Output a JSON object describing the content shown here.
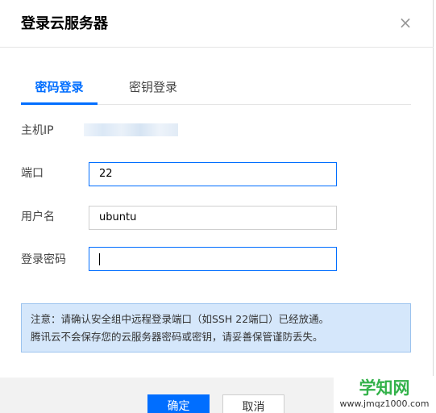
{
  "dialog": {
    "title": "登录云服务器",
    "close_glyph": "×"
  },
  "tabs": [
    {
      "label": "密码登录",
      "active": true
    },
    {
      "label": "密钥登录",
      "active": false
    }
  ],
  "form": {
    "host_label": "主机IP",
    "port_label": "端口",
    "port_value": "22",
    "user_label": "用户名",
    "user_value": "ubuntu",
    "password_label": "登录密码",
    "password_value": ""
  },
  "notice": {
    "line1": "注意：请确认安全组中远程登录端口（如SSH 22端口）已经放通。",
    "line2": "腾讯云不会保存您的云服务器密码或密钥，请妥善保管谨防丢失。"
  },
  "buttons": {
    "confirm": "确定",
    "cancel": "取消"
  },
  "watermark": {
    "title": "学知网",
    "url": "www.jmqz1000.com"
  },
  "colors": {
    "accent": "#006eff",
    "notice_bg": "#d5e7fb",
    "watermark_green": "#33b24a"
  }
}
